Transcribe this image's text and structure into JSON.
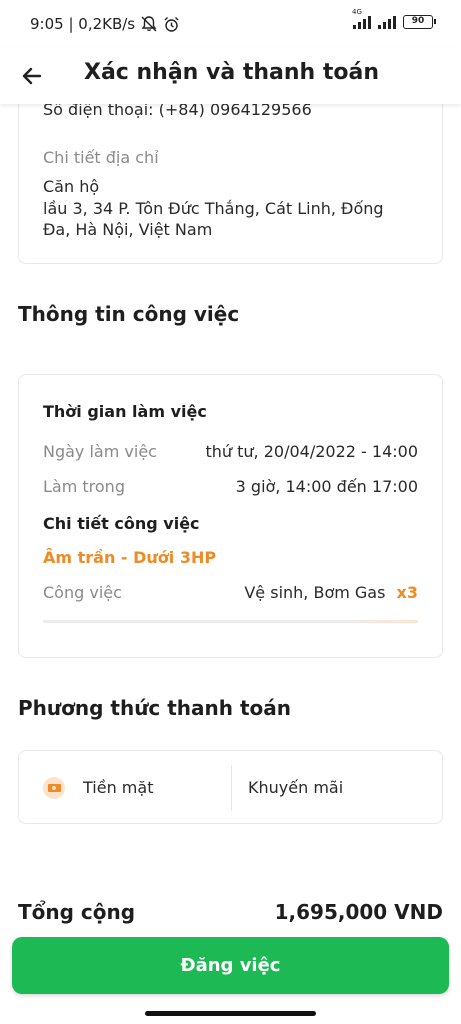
{
  "status_bar": {
    "time_speed": "9:05 | 0,2KB/s",
    "network_label": "4G",
    "battery": "90"
  },
  "header": {
    "title": "Xác nhận và thanh toán"
  },
  "address": {
    "phone": "Sô điện thoại: (+84) 0964129566",
    "detail_label": "Chi tiết địa chỉ",
    "line1": "Căn hộ",
    "line2": "lầu 3, 34 P. Tôn Đức Thắng, Cát Linh, Đống",
    "line3": "Đa, Hà Nội, Việt Nam"
  },
  "job": {
    "section_title": "Thông tin công việc",
    "time_title": "Thời gian làm việc",
    "date_label": "Ngày làm việc",
    "date_value": "thứ tư, 20/04/2022 - 14:00",
    "duration_label": "Làm trong",
    "duration_value": "3 giờ, 14:00 đến 17:00",
    "detail_title": "Chi tiết công việc",
    "service_name": "Âm trần - Dưới 3HP",
    "task_label": "Công việc",
    "task_value": "Vệ sinh, Bơm Gas",
    "task_qty": "x3"
  },
  "payment": {
    "section_title": "Phương thức thanh toán",
    "method": "Tiền mặt",
    "promo": "Khuyến mãi"
  },
  "total": {
    "label": "Tổng cộng",
    "value": "1,695,000 VND"
  },
  "submit_label": "Đăng việc",
  "colors": {
    "accent_green": "#1db954",
    "accent_orange": "#f08a24"
  }
}
